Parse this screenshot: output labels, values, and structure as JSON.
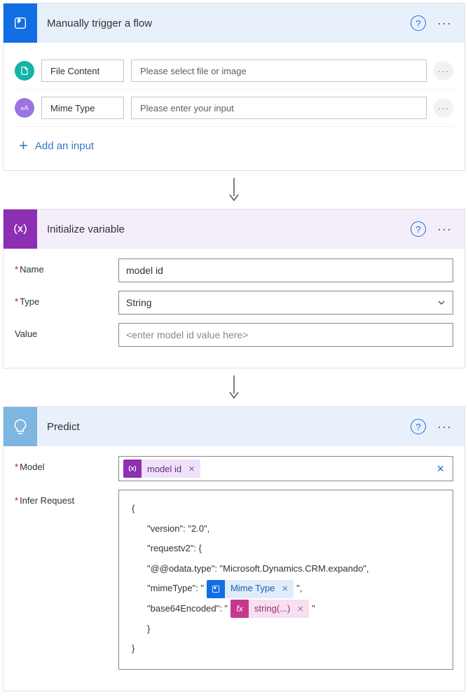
{
  "trigger": {
    "title": "Manually trigger a flow",
    "inputs": [
      {
        "icon": "file",
        "label": "File Content",
        "placeholder": "Please select file or image"
      },
      {
        "icon": "text",
        "label": "Mime Type",
        "placeholder": "Please enter your input"
      }
    ],
    "add_label": "Add an input"
  },
  "initvar": {
    "title": "Initialize variable",
    "name_label": "Name",
    "name_value": "model id",
    "type_label": "Type",
    "type_value": "String",
    "value_label": "Value",
    "value_placeholder": "<enter model id value here>"
  },
  "predict": {
    "title": "Predict",
    "model_label": "Model",
    "model_token": "model id",
    "infer_label": "Infer Request",
    "code": {
      "line1": "{",
      "line2": "\"version\": \"2.0\",",
      "line3": "\"requestv2\": {",
      "line4": "\"@@odata.type\": \"Microsoft.Dynamics.CRM.expando\",",
      "line5a": "\"mimeType\": \"",
      "line5_token": "Mime Type",
      "line5b": "\",",
      "line6a": "\"base64Encoded\": \"",
      "line6_token": "string(...)",
      "line6b": "\"",
      "line7": "}",
      "line8": "}"
    }
  }
}
